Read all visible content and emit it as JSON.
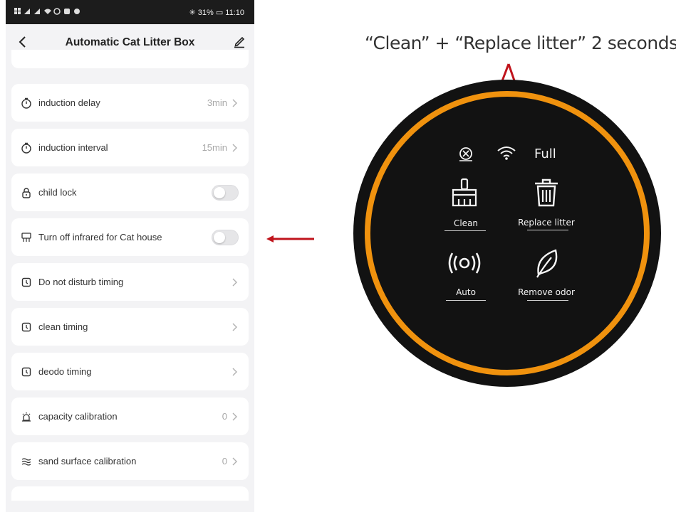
{
  "status_bar": {
    "left_icons": "⚡…",
    "right_text": "✳ 31% ▭ 11:10"
  },
  "header": {
    "title": "Automatic Cat Litter Box"
  },
  "settings": [
    {
      "label": "induction delay",
      "value": "3min",
      "control": "chevron",
      "icon": "timer-icon"
    },
    {
      "label": "induction interval",
      "value": "15min",
      "control": "chevron",
      "icon": "timer-icon"
    },
    {
      "label": "child lock",
      "value": "",
      "control": "toggle",
      "icon": "lock-icon",
      "toggled": false
    },
    {
      "label": "Turn off infrared for Cat house",
      "value": "",
      "control": "toggle",
      "icon": "cat-house-icon",
      "toggled": false
    },
    {
      "label": "Do not disturb timing",
      "value": "",
      "control": "chevron",
      "icon": "alarm-clock-icon"
    },
    {
      "label": "clean timing",
      "value": "",
      "control": "chevron",
      "icon": "alarm-clock-icon"
    },
    {
      "label": "deodo timing",
      "value": "",
      "control": "chevron",
      "icon": "alarm-clock-icon"
    },
    {
      "label": "capacity calibration",
      "value": "0",
      "control": "chevron",
      "icon": "alarm-bell-icon"
    },
    {
      "label": "sand surface calibration",
      "value": "0",
      "control": "chevron",
      "icon": "waves-icon"
    }
  ],
  "annotation": {
    "instruction": "“Clean” + “Replace litter” 2 seconds",
    "arrow_color": "#c0141c"
  },
  "device_panel": {
    "status_full": "Full",
    "buttons": [
      {
        "label": "Clean",
        "icon": "broom-icon"
      },
      {
        "label": "Replace litter",
        "icon": "trash-icon"
      },
      {
        "label": "Auto",
        "icon": "signal-waves-icon"
      },
      {
        "label": "Remove odor",
        "icon": "leaf-icon"
      }
    ],
    "ring_color": "#f0920e",
    "face_color": "#121212"
  }
}
